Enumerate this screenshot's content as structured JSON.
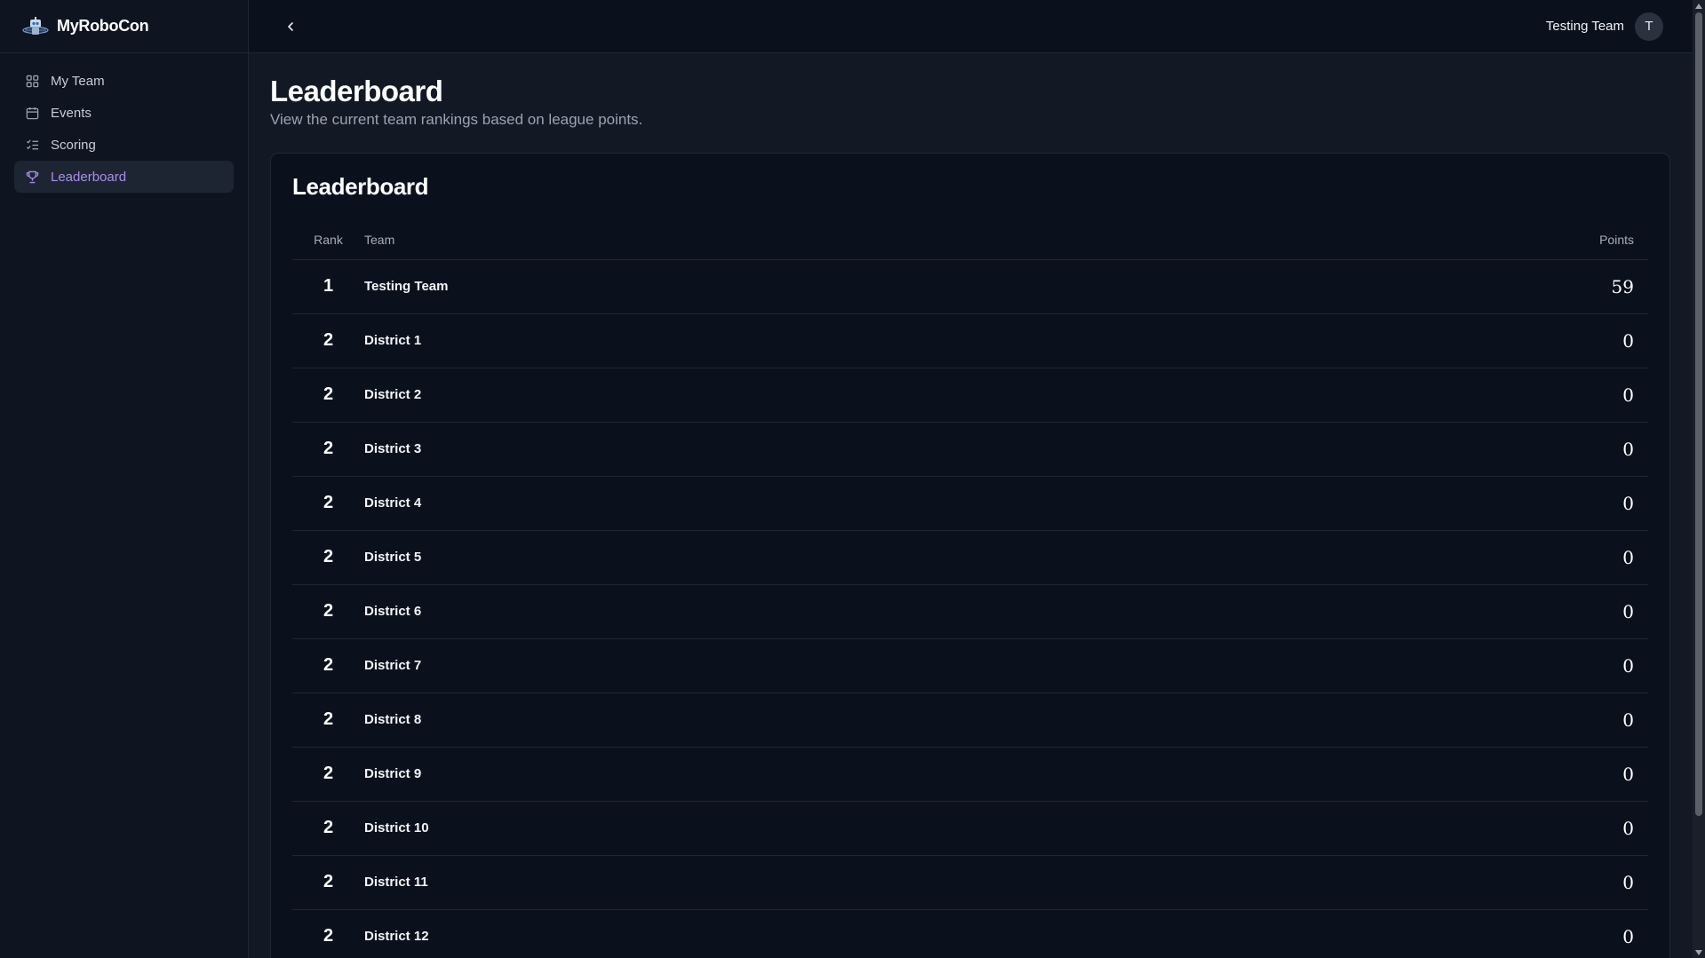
{
  "app": {
    "name": "MyRoboCon"
  },
  "sidebar": {
    "items": [
      {
        "label": "My Team",
        "icon": "dashboard-icon",
        "active": false
      },
      {
        "label": "Events",
        "icon": "calendar-icon",
        "active": false
      },
      {
        "label": "Scoring",
        "icon": "list-check-icon",
        "active": false
      },
      {
        "label": "Leaderboard",
        "icon": "trophy-icon",
        "active": true
      }
    ]
  },
  "header": {
    "user_name": "Testing Team",
    "avatar_initial": "T"
  },
  "page": {
    "title": "Leaderboard",
    "subtitle": "View the current team rankings based on league points."
  },
  "leaderboard": {
    "title": "Leaderboard",
    "columns": {
      "rank": "Rank",
      "team": "Team",
      "points": "Points"
    },
    "rows": [
      {
        "rank": "1",
        "team": "Testing Team",
        "points": "59"
      },
      {
        "rank": "2",
        "team": "District 1",
        "points": "0"
      },
      {
        "rank": "2",
        "team": "District 2",
        "points": "0"
      },
      {
        "rank": "2",
        "team": "District 3",
        "points": "0"
      },
      {
        "rank": "2",
        "team": "District 4",
        "points": "0"
      },
      {
        "rank": "2",
        "team": "District 5",
        "points": "0"
      },
      {
        "rank": "2",
        "team": "District 6",
        "points": "0"
      },
      {
        "rank": "2",
        "team": "District 7",
        "points": "0"
      },
      {
        "rank": "2",
        "team": "District 8",
        "points": "0"
      },
      {
        "rank": "2",
        "team": "District 9",
        "points": "0"
      },
      {
        "rank": "2",
        "team": "District 10",
        "points": "0"
      },
      {
        "rank": "2",
        "team": "District 11",
        "points": "0"
      },
      {
        "rank": "2",
        "team": "District 12",
        "points": "0"
      }
    ]
  },
  "colors": {
    "background": "#0b111c",
    "sidebar": "#0e1420",
    "accent": "#a98ee8",
    "border": "#1f2733"
  }
}
